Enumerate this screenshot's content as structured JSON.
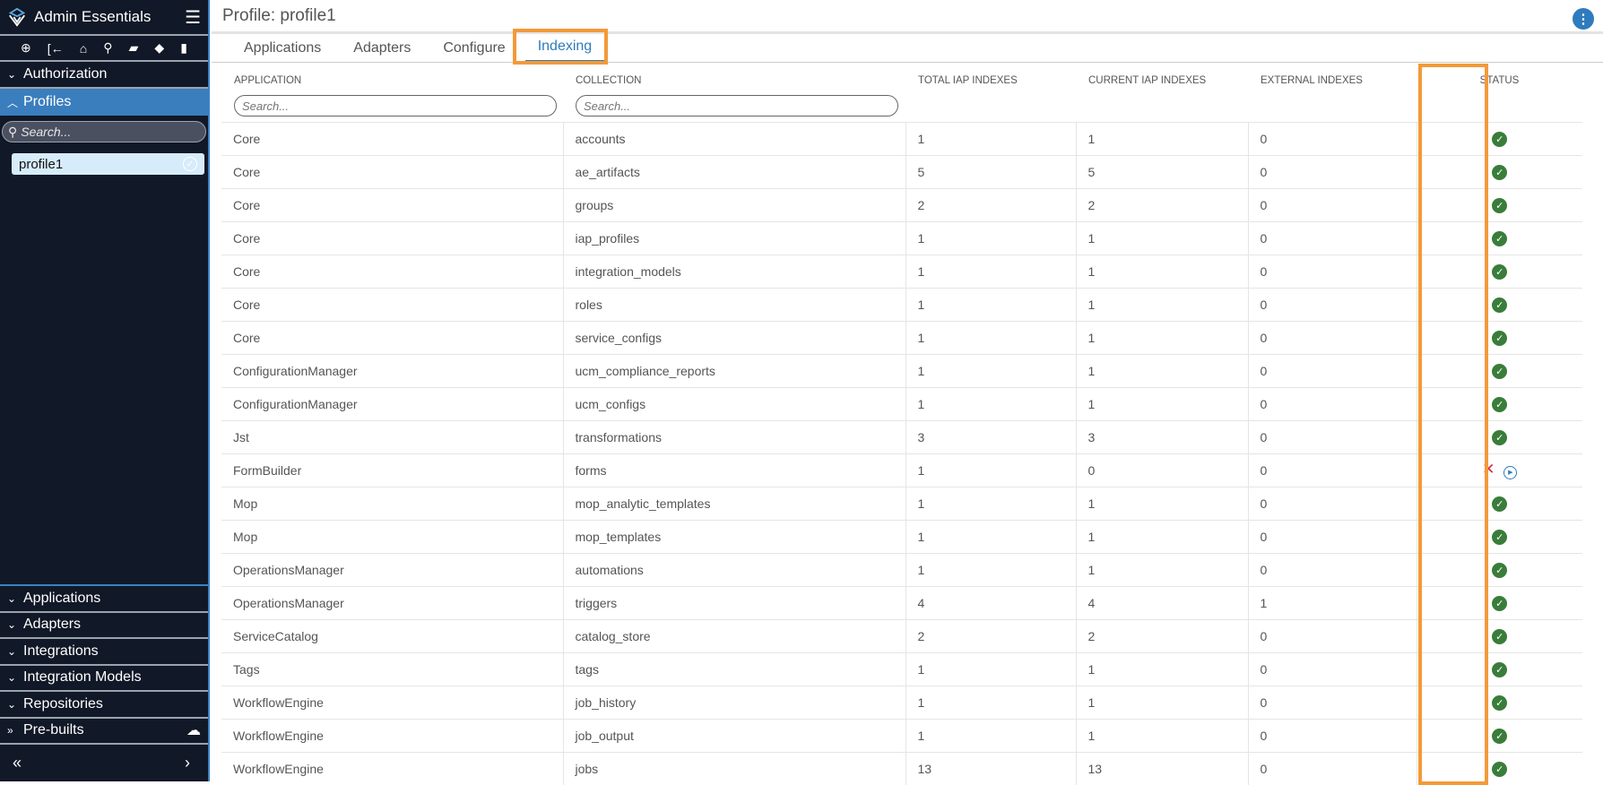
{
  "sidebar": {
    "app_title": "Admin Essentials",
    "search_placeholder": "Search...",
    "profile_item": "profile1",
    "sections_top": [
      {
        "label": "Authorization",
        "expanded": false
      },
      {
        "label": "Profiles",
        "expanded": true
      }
    ],
    "sections_bottom": [
      "Applications",
      "Adapters",
      "Integrations",
      "Integration Models",
      "Repositories",
      "Pre-builts"
    ]
  },
  "main": {
    "title": "Profile: profile1",
    "tabs": [
      "Applications",
      "Adapters",
      "Configure",
      "Indexing"
    ],
    "active_tab": "Indexing",
    "columns": [
      "APPLICATION",
      "COLLECTION",
      "TOTAL IAP INDEXES",
      "CURRENT IAP INDEXES",
      "EXTERNAL INDEXES",
      "STATUS"
    ],
    "search_placeholder": "Search...",
    "rows": [
      [
        "Core",
        "accounts",
        "1",
        "1",
        "0",
        "ok"
      ],
      [
        "Core",
        "ae_artifacts",
        "5",
        "5",
        "0",
        "ok"
      ],
      [
        "Core",
        "groups",
        "2",
        "2",
        "0",
        "ok"
      ],
      [
        "Core",
        "iap_profiles",
        "1",
        "1",
        "0",
        "ok"
      ],
      [
        "Core",
        "integration_models",
        "1",
        "1",
        "0",
        "ok"
      ],
      [
        "Core",
        "roles",
        "1",
        "1",
        "0",
        "ok"
      ],
      [
        "Core",
        "service_configs",
        "1",
        "1",
        "0",
        "ok"
      ],
      [
        "ConfigurationManager",
        "ucm_compliance_reports",
        "1",
        "1",
        "0",
        "ok"
      ],
      [
        "ConfigurationManager",
        "ucm_configs",
        "1",
        "1",
        "0",
        "ok"
      ],
      [
        "Jst",
        "transformations",
        "3",
        "3",
        "0",
        "ok"
      ],
      [
        "FormBuilder",
        "forms",
        "1",
        "0",
        "0",
        "error"
      ],
      [
        "Mop",
        "mop_analytic_templates",
        "1",
        "1",
        "0",
        "ok"
      ],
      [
        "Mop",
        "mop_templates",
        "1",
        "1",
        "0",
        "ok"
      ],
      [
        "OperationsManager",
        "automations",
        "1",
        "1",
        "0",
        "ok"
      ],
      [
        "OperationsManager",
        "triggers",
        "4",
        "4",
        "1",
        "ok"
      ],
      [
        "ServiceCatalog",
        "catalog_store",
        "2",
        "2",
        "0",
        "ok"
      ],
      [
        "Tags",
        "tags",
        "1",
        "1",
        "0",
        "ok"
      ],
      [
        "WorkflowEngine",
        "job_history",
        "1",
        "1",
        "0",
        "ok"
      ],
      [
        "WorkflowEngine",
        "job_output",
        "1",
        "1",
        "0",
        "ok"
      ],
      [
        "WorkflowEngine",
        "jobs",
        "13",
        "13",
        "0",
        "ok"
      ]
    ]
  },
  "colors": {
    "accent": "#2f7bbd",
    "highlight": "#f29a38",
    "ok": "#3a7d3a",
    "error": "#d9263b",
    "sidebar": "#111827"
  }
}
